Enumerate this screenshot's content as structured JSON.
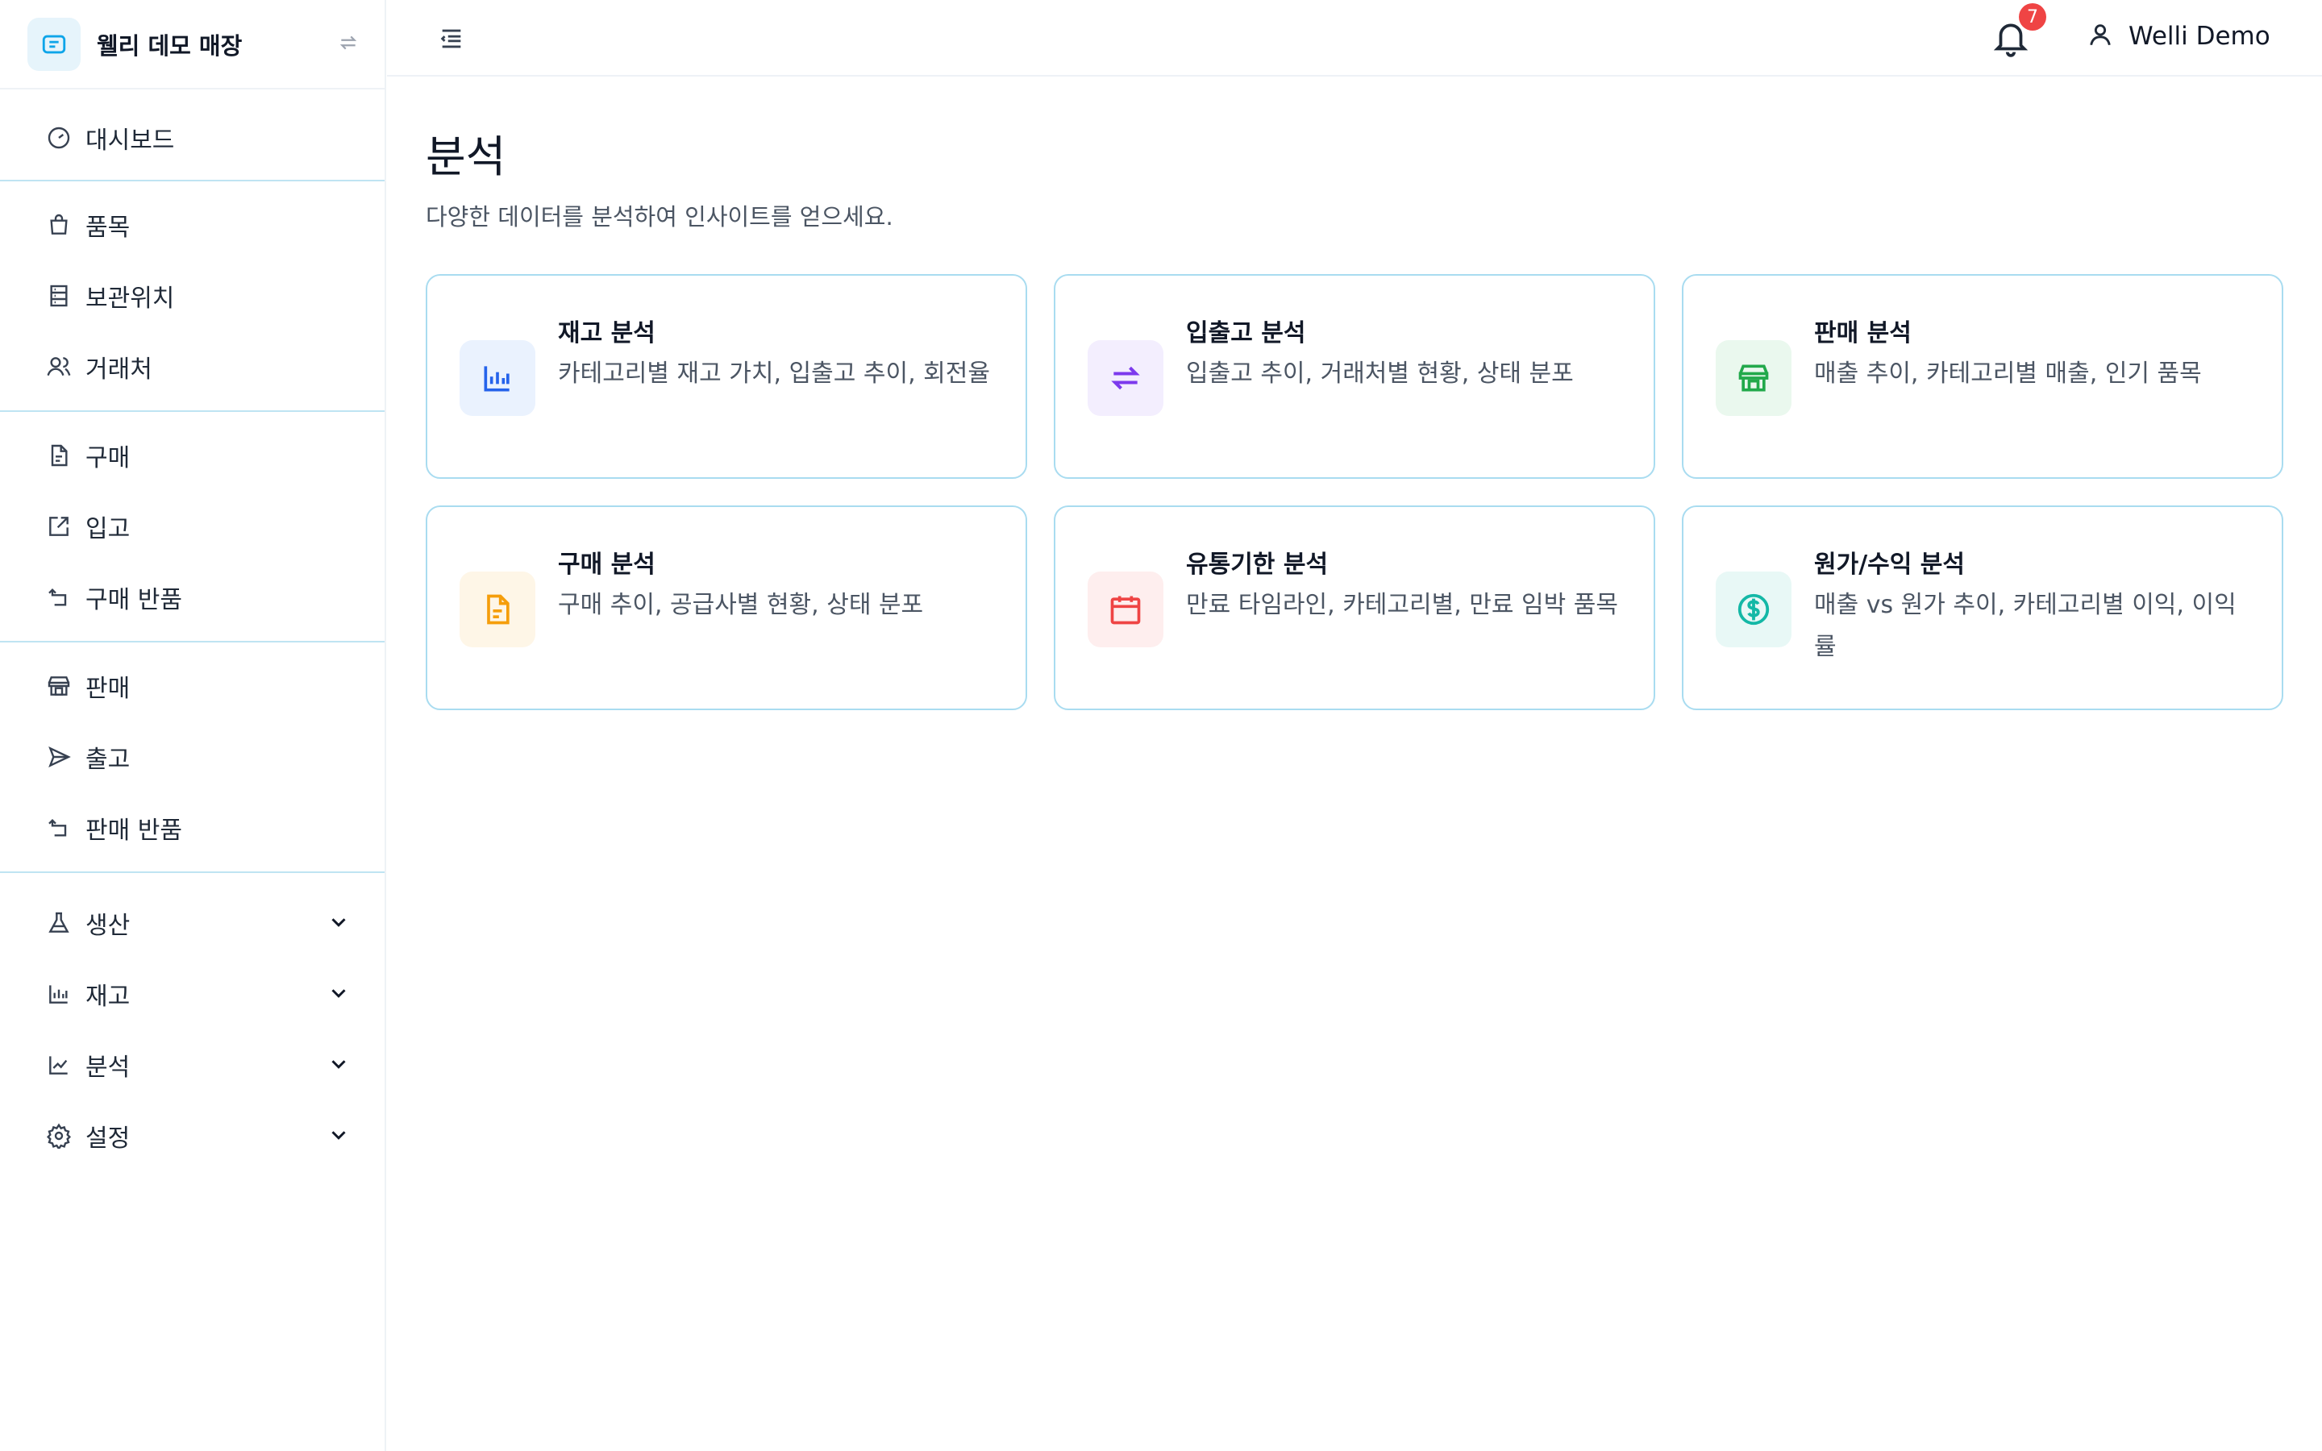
{
  "store": {
    "name": "웰리 데모 매장"
  },
  "nav": {
    "dashboard": "대시보드",
    "items": "품목",
    "storage": "보관위치",
    "clients": "거래처",
    "purchase": "구매",
    "receiving": "입고",
    "purchase_return": "구매 반품",
    "sales": "판매",
    "shipping": "출고",
    "sales_return": "판매 반품",
    "production": "생산",
    "inventory": "재고",
    "analytics": "분석",
    "settings": "설정"
  },
  "header": {
    "notification_count": "7",
    "user_name": "Welli Demo"
  },
  "page": {
    "title": "분석",
    "subtitle": "다양한 데이터를 분석하여 인사이트를 얻으세요."
  },
  "cards": [
    {
      "title": "재고 분석",
      "desc": "카테고리별 재고 가치, 입출고 추이, 회전율",
      "icon": "bar-chart-icon",
      "color": "#2563eb",
      "bg": "#eaf2fe"
    },
    {
      "title": "입출고 분석",
      "desc": "입출고 추이, 거래처별 현황, 상태 분포",
      "icon": "arrows-swap-icon",
      "color": "#7c3aed",
      "bg": "#f3eefe"
    },
    {
      "title": "판매 분석",
      "desc": "매출 추이, 카테고리별 매출, 인기 품목",
      "icon": "store-icon",
      "color": "#22a94b",
      "bg": "#eaf8ee"
    },
    {
      "title": "구매 분석",
      "desc": "구매 추이, 공급사별 현황, 상태 분포",
      "icon": "document-icon",
      "color": "#f59e0b",
      "bg": "#fef6e7"
    },
    {
      "title": "유통기한 분석",
      "desc": "만료 타임라인, 카테고리별, 만료 임박 품목",
      "icon": "calendar-icon",
      "color": "#ef4444",
      "bg": "#feeeee"
    },
    {
      "title": "원가/수익 분석",
      "desc": "매출 vs 원가 추이, 카테고리별 이익, 이익률",
      "icon": "dollar-icon",
      "color": "#14b8a6",
      "bg": "#e8f8f6"
    }
  ]
}
